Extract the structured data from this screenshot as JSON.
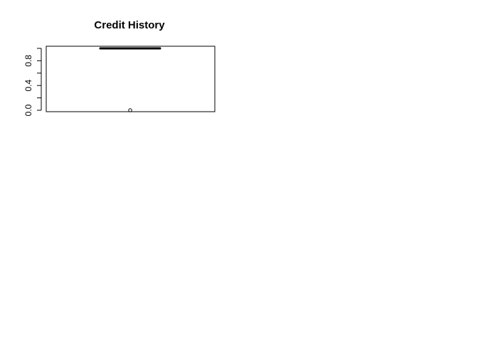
{
  "chart_data": {
    "type": "box",
    "title": "Credit History",
    "xlabel": "",
    "ylabel": "",
    "ylim": [
      0,
      1
    ],
    "yticks": [
      0.0,
      0.2,
      0.4,
      0.6,
      0.8,
      1.0
    ],
    "ytick_labels": [
      "0.0",
      "0.4",
      "0.8"
    ],
    "box": {
      "min": 1.0,
      "q1": 1.0,
      "median": 1.0,
      "q3": 1.0,
      "max": 1.0,
      "outliers": [
        0.0
      ]
    },
    "grid": false,
    "legend": "none"
  }
}
